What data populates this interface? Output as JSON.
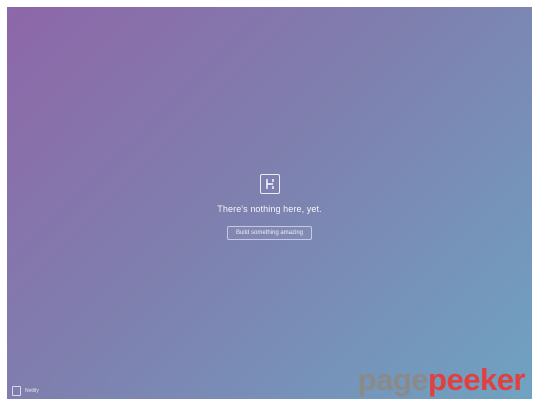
{
  "page": {
    "message": "There's nothing here, yet.",
    "action_label": "Build something amazing",
    "logo_icon": "frame-logo-icon"
  },
  "footer": {
    "label": "Netlify"
  },
  "watermark": {
    "part1": "page",
    "part2": "peeker"
  },
  "colors": {
    "gradient_start": "#8e67a9",
    "gradient_end": "#6fa3c2",
    "watermark_gray": "#8a8a8a",
    "watermark_red": "#e04040"
  }
}
